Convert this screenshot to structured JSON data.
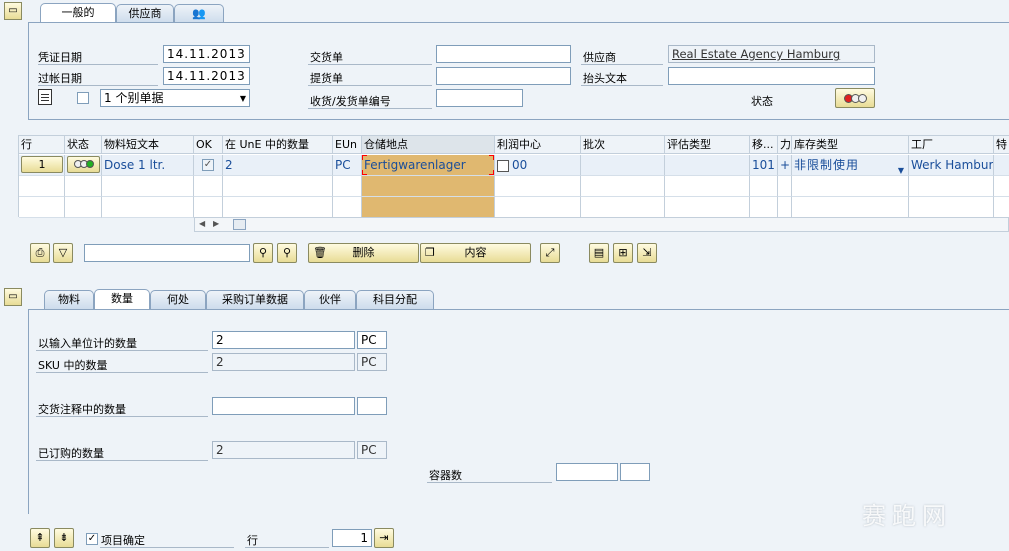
{
  "header": {
    "tabs": [
      {
        "label": "一般的"
      },
      {
        "label": "供应商"
      }
    ],
    "fields": {
      "doc_date_label": "凭证日期",
      "doc_date": "14.11.2013",
      "post_date_label": "过帐日期",
      "post_date": "14.11.2013",
      "slip_value": "1 个别单据",
      "delivery_note_label": "交货单",
      "delivery_note": "",
      "bill_of_lading_label": "提货单",
      "bill_of_lading": "",
      "gr_slip_label": "收货/发货单编号",
      "gr_slip": "",
      "vendor_label": "供应商",
      "vendor_value": "Real Estate Agency Hamburg",
      "header_text_label": "抬头文本",
      "header_text": "",
      "status_label": "状态"
    }
  },
  "items_table": {
    "columns": [
      "行",
      "状态",
      "物料短文本",
      "OK",
      "在 UnE 中的数量",
      "EUn",
      "仓储地点",
      "利润中心",
      "批次",
      "评估类型",
      "移...",
      "力",
      "库存类型",
      "工厂",
      "特"
    ],
    "row": {
      "line": "1",
      "material_text": "Dose 1 ltr.",
      "quantity": "2",
      "unit": "PC",
      "storage_location": "Fertigwarenlager",
      "profit_center": "00",
      "movement_type": "101",
      "plus": "+",
      "stock_type": "非限制使用",
      "plant": "Werk Hamburg"
    }
  },
  "toolbar": {
    "search_value": "",
    "delete_label": "删除",
    "contents_label": "内容"
  },
  "detail": {
    "tabs": [
      {
        "label": "物料"
      },
      {
        "label": "数量"
      },
      {
        "label": "何处"
      },
      {
        "label": "采购订单数据"
      },
      {
        "label": "伙伴"
      },
      {
        "label": "科目分配"
      }
    ],
    "qty_entry_label": "以输入单位计的数量",
    "qty_entry": "2",
    "qty_entry_unit": "PC",
    "qty_sku_label": "SKU 中的数量",
    "qty_sku": "2",
    "qty_sku_unit": "PC",
    "qty_delivery_note_label": "交货注释中的数量",
    "qty_delivery_note": "",
    "qty_delivery_note_unit": "",
    "qty_ordered_label": "已订购的数量",
    "qty_ordered": "2",
    "qty_ordered_unit": "PC",
    "containers_label": "容器数",
    "containers": "",
    "containers_unit": ""
  },
  "footer": {
    "item_ok_label": "项目确定",
    "row_label": "行",
    "row_value": "1"
  },
  "watermark": {
    "text": "赛跑网"
  },
  "colors": {
    "accent_tab_border": "#8ba4c0",
    "selected_cell": "#e0b870",
    "button_gradient": "#e8dc96"
  }
}
